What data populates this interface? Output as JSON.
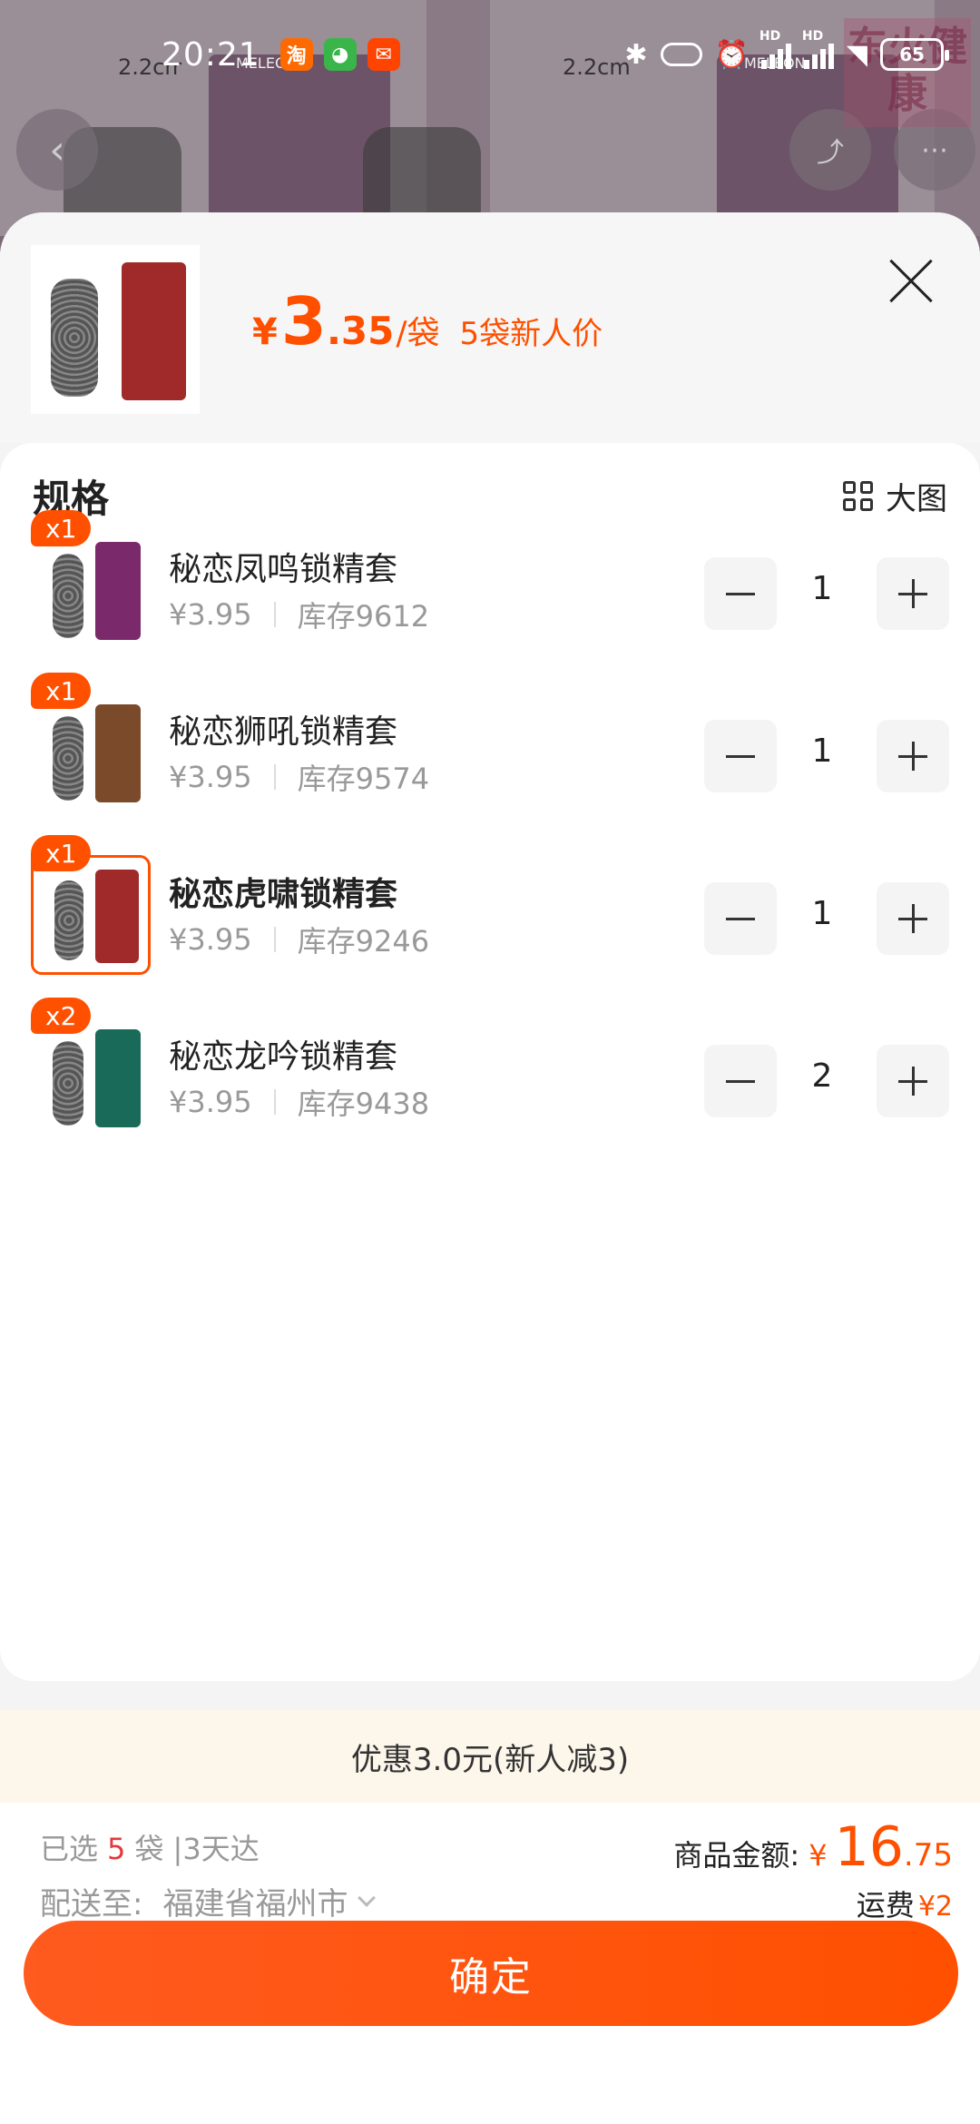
{
  "status_bar": {
    "time": "20:21",
    "battery": "65",
    "hd1": "HD",
    "hd2": "HD"
  },
  "background": {
    "size_label_1": "2.2cm",
    "size_label_2": "2.2cm",
    "brand_1": "MELEON",
    "brand_2": "MELEON",
    "badge": "东火健康"
  },
  "header": {
    "currency": "¥",
    "price_int": "3",
    "price_dec": ".35",
    "unit": "/袋",
    "promo_tag": "5袋新人价"
  },
  "spec": {
    "title": "规格",
    "big_view_label": "大图"
  },
  "items": [
    {
      "badge": "x1",
      "name": "秘恋凤鸣锁精套",
      "price": "¥3.95",
      "stock": "库存9612",
      "qty": "1",
      "color": "#7a2a6a",
      "selected": false
    },
    {
      "badge": "x1",
      "name": "秘恋狮吼锁精套",
      "price": "¥3.95",
      "stock": "库存9574",
      "qty": "1",
      "color": "#7a4a2a",
      "selected": false
    },
    {
      "badge": "x1",
      "name": "秘恋虎啸锁精套",
      "price": "¥3.95",
      "stock": "库存9246",
      "qty": "1",
      "color": "#a02a2a",
      "selected": true
    },
    {
      "badge": "x2",
      "name": "秘恋龙吟锁精套",
      "price": "¥3.95",
      "stock": "库存9438",
      "qty": "2",
      "color": "#1a6a5a",
      "selected": false
    }
  ],
  "discount_text": "优惠3.0元(新人减3)",
  "summary": {
    "selected_prefix": "已选",
    "selected_count": "5",
    "selected_suffix": "袋 |3天达",
    "amount_label": "商品金额:",
    "amount_currency": "¥",
    "amount_int": "16",
    "amount_dec": ".75",
    "ship_label": "配送至:",
    "ship_addr": "福建省福州市",
    "fee_label": "运费",
    "fee_value": "¥2"
  },
  "confirm_label": "确定",
  "colors": {
    "accent": "#ff5000",
    "discount_bg": "#fdf6ea"
  }
}
